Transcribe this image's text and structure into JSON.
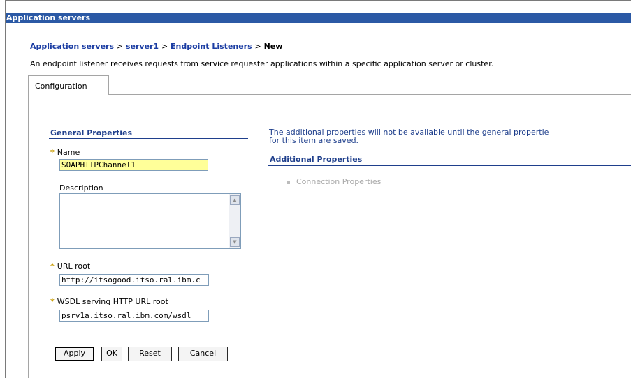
{
  "window": {
    "title": "Application servers"
  },
  "breadcrumb": {
    "items": [
      "Application servers",
      "server1",
      "Endpoint Listeners"
    ],
    "separator": ">",
    "current": "New"
  },
  "intro_text": "An endpoint listener receives requests from service requester applications within a specific application server or cluster.",
  "tabs": [
    {
      "label": "Configuration",
      "selected": true
    }
  ],
  "general_properties": {
    "heading": "General Properties",
    "required_marker": "*",
    "name": {
      "label": "Name",
      "value": "SOAPHTTPChannel1",
      "required": true
    },
    "description": {
      "label": "Description",
      "value": ""
    },
    "url_root": {
      "label": "URL root",
      "value": "http://itsogood.itso.ral.ibm.c",
      "required": true
    },
    "wsdl_root": {
      "label": "WSDL serving HTTP URL root",
      "value": "psrv1a.itso.ral.ibm.com/wsdl",
      "required": true
    }
  },
  "additional": {
    "note_line1": "The additional properties will not be available until the general propertie",
    "note_line2": "for this item are saved.",
    "heading": "Additional Properties",
    "items": [
      {
        "label": "Connection Properties",
        "enabled": false
      }
    ]
  },
  "buttons": {
    "apply": "Apply",
    "ok": "OK",
    "reset": "Reset",
    "cancel": "Cancel"
  },
  "colors": {
    "titlebar": "#2b59a5",
    "link": "#1b3da3",
    "heading": "#1f3f8c",
    "required": "#c89b00",
    "highlight_field": "#ffff99"
  }
}
